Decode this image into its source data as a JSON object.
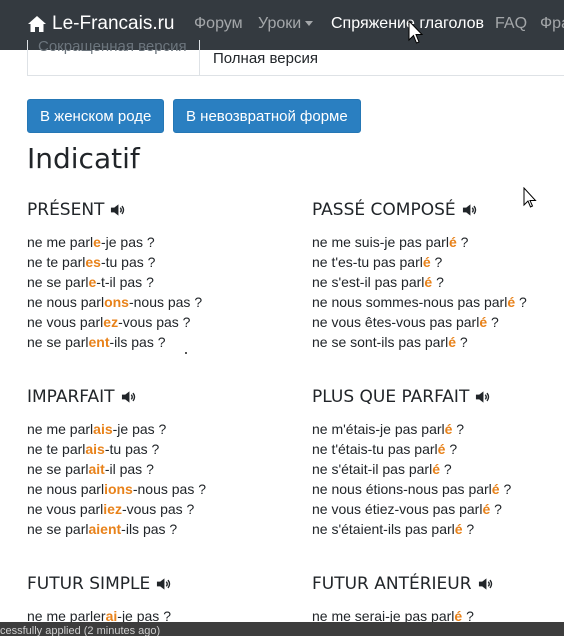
{
  "nav": {
    "brand": "Le-Francais.ru",
    "items": [
      "Форум",
      "Уроки",
      "Спряжение глаголов",
      "FAQ",
      "Фра"
    ]
  },
  "tabs": {
    "short": "Сокращенная версия",
    "full": "Полная версия"
  },
  "buttons": {
    "feminine": "В женском роде",
    "non_reflexive": "В невозвратной форме"
  },
  "mood": "Indicatif",
  "tenses": [
    {
      "name": "PRÉSENT",
      "lines": [
        [
          "ne me parl",
          "e",
          "-je pas ?"
        ],
        [
          "ne te parl",
          "es",
          "-tu pas ?"
        ],
        [
          "ne se parl",
          "e",
          "-t-il pas ?"
        ],
        [
          "ne nous parl",
          "ons",
          "-nous pas ?"
        ],
        [
          "ne vous parl",
          "ez",
          "-vous pas ?"
        ],
        [
          "ne se parl",
          "ent",
          "-ils pas ?"
        ]
      ]
    },
    {
      "name": "PASSÉ COMPOSÉ",
      "lines": [
        [
          "ne me suis-je pas parl",
          "é",
          " ?"
        ],
        [
          "ne t'es-tu pas parl",
          "é",
          " ?"
        ],
        [
          "ne s'est-il pas parl",
          "é",
          " ?"
        ],
        [
          "ne nous sommes-nous pas parl",
          "é",
          " ?"
        ],
        [
          "ne vous êtes-vous pas parl",
          "é",
          " ?"
        ],
        [
          "ne se sont-ils pas parl",
          "é",
          " ?"
        ]
      ]
    },
    {
      "name": "IMPARFAIT",
      "lines": [
        [
          "ne me parl",
          "ais",
          "-je pas ?"
        ],
        [
          "ne te parl",
          "ais",
          "-tu pas ?"
        ],
        [
          "ne se parl",
          "ait",
          "-il pas ?"
        ],
        [
          "ne nous parl",
          "ions",
          "-nous pas ?"
        ],
        [
          "ne vous parl",
          "iez",
          "-vous pas ?"
        ],
        [
          "ne se parl",
          "aient",
          "-ils pas ?"
        ]
      ]
    },
    {
      "name": "PLUS QUE PARFAIT",
      "lines": [
        [
          "ne m'étais-je pas parl",
          "é",
          " ?"
        ],
        [
          "ne t'étais-tu pas parl",
          "é",
          " ?"
        ],
        [
          "ne s'était-il pas parl",
          "é",
          " ?"
        ],
        [
          "ne nous étions-nous pas parl",
          "é",
          " ?"
        ],
        [
          "ne vous étiez-vous pas parl",
          "é",
          " ?"
        ],
        [
          "ne s'étaient-ils pas parl",
          "é",
          " ?"
        ]
      ]
    },
    {
      "name": "FUTUR SIMPLE",
      "lines": [
        [
          "ne me parler",
          "ai",
          "-je pas ?"
        ]
      ]
    },
    {
      "name": "FUTUR ANTÉRIEUR",
      "lines": [
        [
          "ne me serai-je pas parl",
          "é",
          " ?"
        ]
      ]
    }
  ],
  "status_text": "cessfully applied (2 minutes ago)",
  "colors": {
    "navbar": "#343a40",
    "button": "#2a7fc1",
    "ending": "#e8821a"
  }
}
